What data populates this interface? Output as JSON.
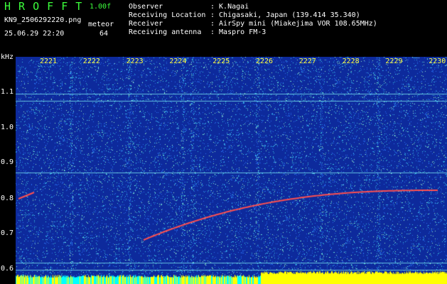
{
  "header": {
    "app_title": "H R O F F T",
    "version": "1.00f",
    "filename": "KN9_2506292220.png",
    "mode_label": "meteor",
    "datetime": "25.06.29 22:20",
    "count": "64",
    "fields": [
      {
        "label": "Observer",
        "value": ": K.Nagai"
      },
      {
        "label": "Receiving Location",
        "value": ": Chigasaki, Japan (139.414 35.340)"
      },
      {
        "label": "Receiver",
        "value": ": AirSpy mini (Miakejima VOR 108.65MHz)"
      },
      {
        "label": "Receiving antenna",
        "value": ": Maspro FM-3"
      }
    ]
  },
  "waterfall": {
    "y_unit": "kHz",
    "y_ticks": [
      "1.1",
      "1.0",
      "0.9",
      "0.8",
      "0.7",
      "0.6"
    ],
    "x_ticks": [
      "2221",
      "2222",
      "2223",
      "2224",
      "2225",
      "2226",
      "2227",
      "2228",
      "2229",
      "2230"
    ]
  },
  "colors": {
    "background": "#000000",
    "waterfall_bg": "#0d2a9c",
    "text": "#ffffff",
    "title": "#3cff3c",
    "tick_text": "#ffff40",
    "trail": "#ff5050",
    "level_high": "#ffff00",
    "level_low": "#00ffff"
  }
}
